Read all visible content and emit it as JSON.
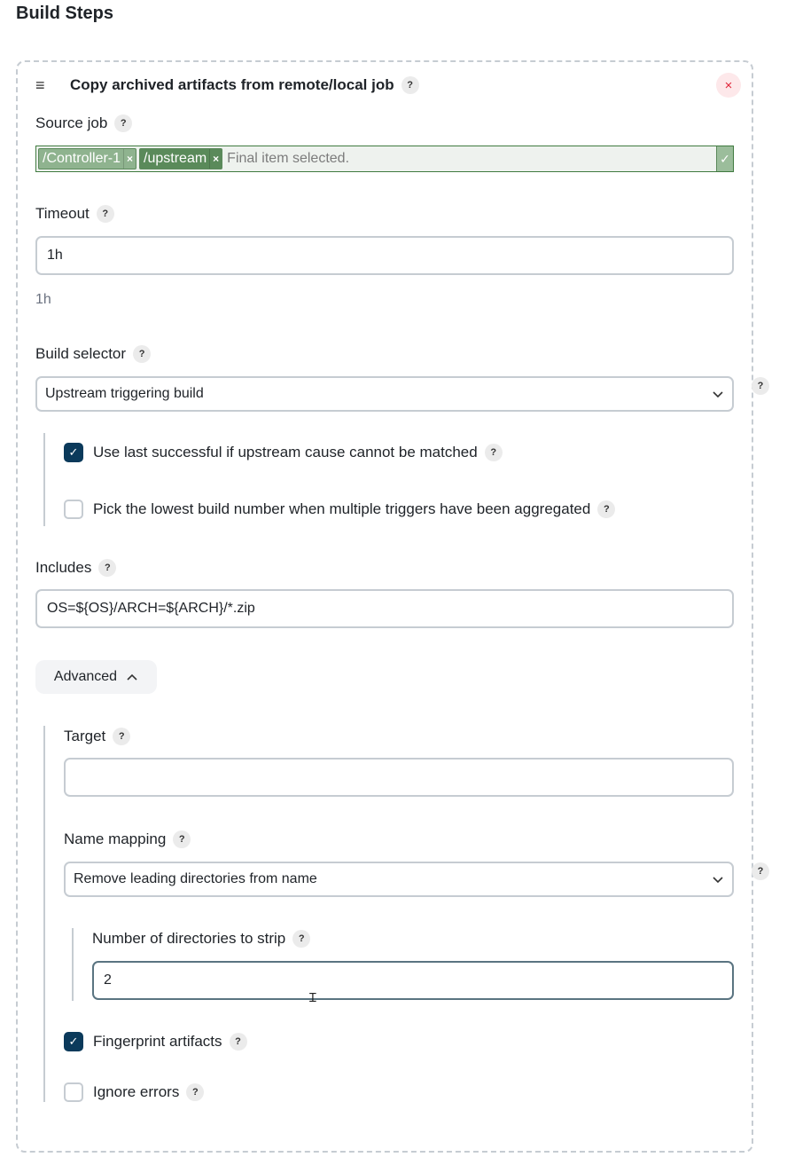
{
  "section": {
    "title": "Build Steps"
  },
  "step": {
    "title": "Copy archived artifacts from remote/local job",
    "help": "?",
    "close_icon": "×",
    "drag_icon": "≡"
  },
  "source_job": {
    "label": "Source job",
    "tags": [
      "/Controller-1",
      "/upstream"
    ],
    "tag_remove": "×",
    "placeholder": "Final item selected.",
    "valid_icon": "✓"
  },
  "timeout": {
    "label": "Timeout",
    "value": "1h",
    "hint": "1h"
  },
  "build_selector": {
    "label": "Build selector",
    "selected": "Upstream triggering build",
    "options": {
      "use_last_successful": {
        "label": "Use last successful if upstream cause cannot be matched",
        "checked": true
      },
      "pick_lowest": {
        "label": "Pick the lowest build number when multiple triggers have been aggregated",
        "checked": false
      }
    }
  },
  "includes": {
    "label": "Includes",
    "value": "OS=${OS}/ARCH=${ARCH}/*.zip"
  },
  "advanced": {
    "label": "Advanced",
    "expanded": true,
    "target": {
      "label": "Target",
      "value": ""
    },
    "name_mapping": {
      "label": "Name mapping",
      "selected": "Remove leading directories from name",
      "strip": {
        "label": "Number of directories to strip",
        "value": "2"
      }
    },
    "fingerprint": {
      "label": "Fingerprint artifacts",
      "checked": true
    },
    "ignore_errors": {
      "label": "Ignore errors",
      "checked": false
    }
  },
  "help_symbol": "?",
  "check_symbol": "✓",
  "colors": {
    "accent": "#0b3a5b",
    "valid_green": "#3f7a3f",
    "close_red": "#e0263a",
    "dashed_border": "#c6ccd2"
  }
}
